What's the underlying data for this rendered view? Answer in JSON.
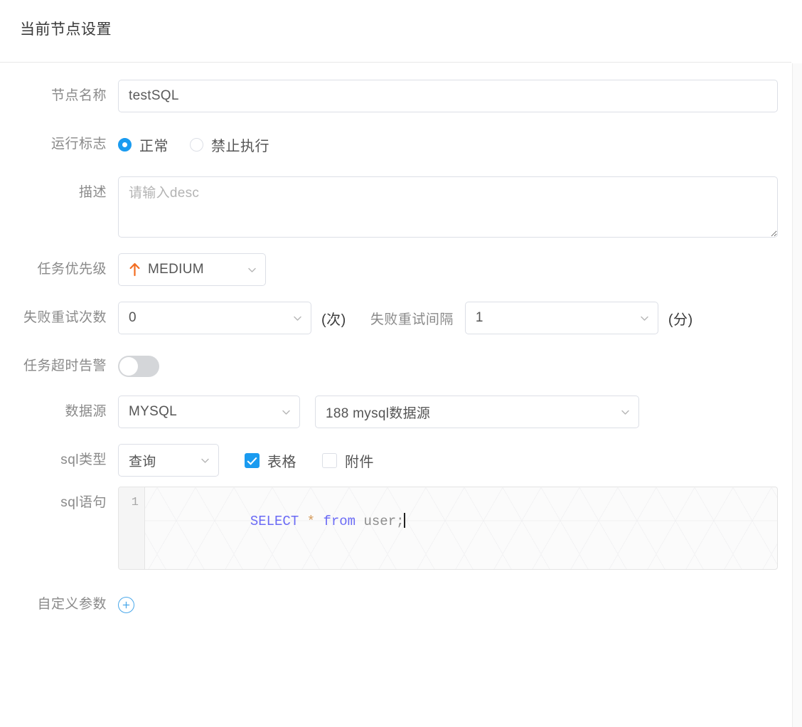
{
  "header": {
    "title": "当前节点设置"
  },
  "form": {
    "node_name": {
      "label": "节点名称",
      "value": "testSQL",
      "placeholder": ""
    },
    "run_flag": {
      "label": "运行标志",
      "options": [
        {
          "label": "正常",
          "checked": true
        },
        {
          "label": "禁止执行",
          "checked": false
        }
      ]
    },
    "description": {
      "label": "描述",
      "value": "",
      "placeholder": "请输入desc"
    },
    "priority": {
      "label": "任务优先级",
      "value": "MEDIUM",
      "arrow_icon": "arrow-up-icon",
      "arrow_color": "#f26d21",
      "caret_icon": "chevron-down-icon"
    },
    "retry_times": {
      "label": "失败重试次数",
      "value": "0",
      "unit": "(次)",
      "caret_icon": "chevron-down-icon"
    },
    "retry_interval": {
      "label": "失败重试间隔",
      "value": "1",
      "unit": "(分)",
      "caret_icon": "chevron-down-icon"
    },
    "timeout_alarm": {
      "label": "任务超时告警",
      "checked": false
    },
    "datasource": {
      "label": "数据源",
      "type_value": "MYSQL",
      "instance_value": "188 mysql数据源",
      "caret_icon": "chevron-down-icon"
    },
    "sql_type": {
      "label": "sql类型",
      "value": "查询",
      "caret_icon": "chevron-down-icon",
      "checkboxes": [
        {
          "label": "表格",
          "checked": true
        },
        {
          "label": "附件",
          "checked": false
        }
      ]
    },
    "sql_statement": {
      "label": "sql语句",
      "line_number": "1",
      "tokens": [
        {
          "text": "SELECT",
          "kind": "keyword"
        },
        {
          "text": " ",
          "kind": "plain"
        },
        {
          "text": "*",
          "kind": "operator"
        },
        {
          "text": " ",
          "kind": "plain"
        },
        {
          "text": "from",
          "kind": "keyword"
        },
        {
          "text": " ",
          "kind": "plain"
        },
        {
          "text": "user;",
          "kind": "identifier"
        }
      ],
      "code": "SELECT * from user;"
    },
    "custom_params": {
      "label": "自定义参数",
      "add_icon": "plus-circle-icon"
    }
  },
  "colors": {
    "accent_blue": "#1a9bf0",
    "priority_orange": "#f26d21",
    "keyword_blue": "#6b6bf5",
    "operator_orange": "#d49a5a",
    "border_gray": "#dcdfe6",
    "label_gray": "#8a8a8a"
  }
}
